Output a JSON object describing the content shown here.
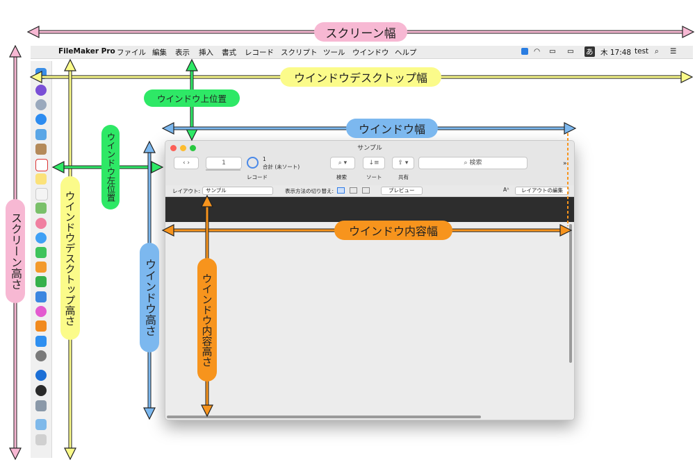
{
  "menubar": {
    "apple": "",
    "app": "FileMaker Pro",
    "items": [
      "ファイル",
      "編集",
      "表示",
      "挿入",
      "書式",
      "レコード",
      "スクリプト",
      "ツール",
      "ウインドウ",
      "ヘルプ"
    ],
    "time": "木 17:48",
    "user": "test",
    "ime": "あ"
  },
  "window": {
    "title": "サンプル",
    "record_field": "1",
    "record_count": "1",
    "record_status": "合計 (未ソート)",
    "record_label": "レコード",
    "find_label": "検索",
    "sort_label": "ソート",
    "share_label": "共有",
    "search_placeholder": "検索",
    "more_glyph": "»",
    "layout_label": "レイアウト:",
    "layout_value": "サンプル",
    "view_label": "表示方法の切り替え:",
    "preview_button": "プレビュー",
    "font_size_glyph": "Aᴬ",
    "edit_layout_button": "レイアウトの編集"
  },
  "labels": {
    "screen_width": "スクリーン幅",
    "window_desktop_width": "ウインドウデスクトップ幅",
    "window_top": "ウインドウ上位置",
    "window_width": "ウインドウ幅",
    "window_left": "ウインドウ左位置",
    "window_content_width": "ウインドウ内容幅",
    "screen_height": "スクリーン高さ",
    "window_desktop_height": "ウインドウデスクトップ高さ",
    "window_height": "ウインドウ高さ",
    "window_content_height": "ウインドウ内容高さ"
  },
  "colors": {
    "pink": "#f7b8d3",
    "yellow": "#fbfb8a",
    "green": "#2ee866",
    "blue": "#7cb8ef",
    "orange": "#f7941d",
    "dark_band": "#2d2d2d"
  }
}
